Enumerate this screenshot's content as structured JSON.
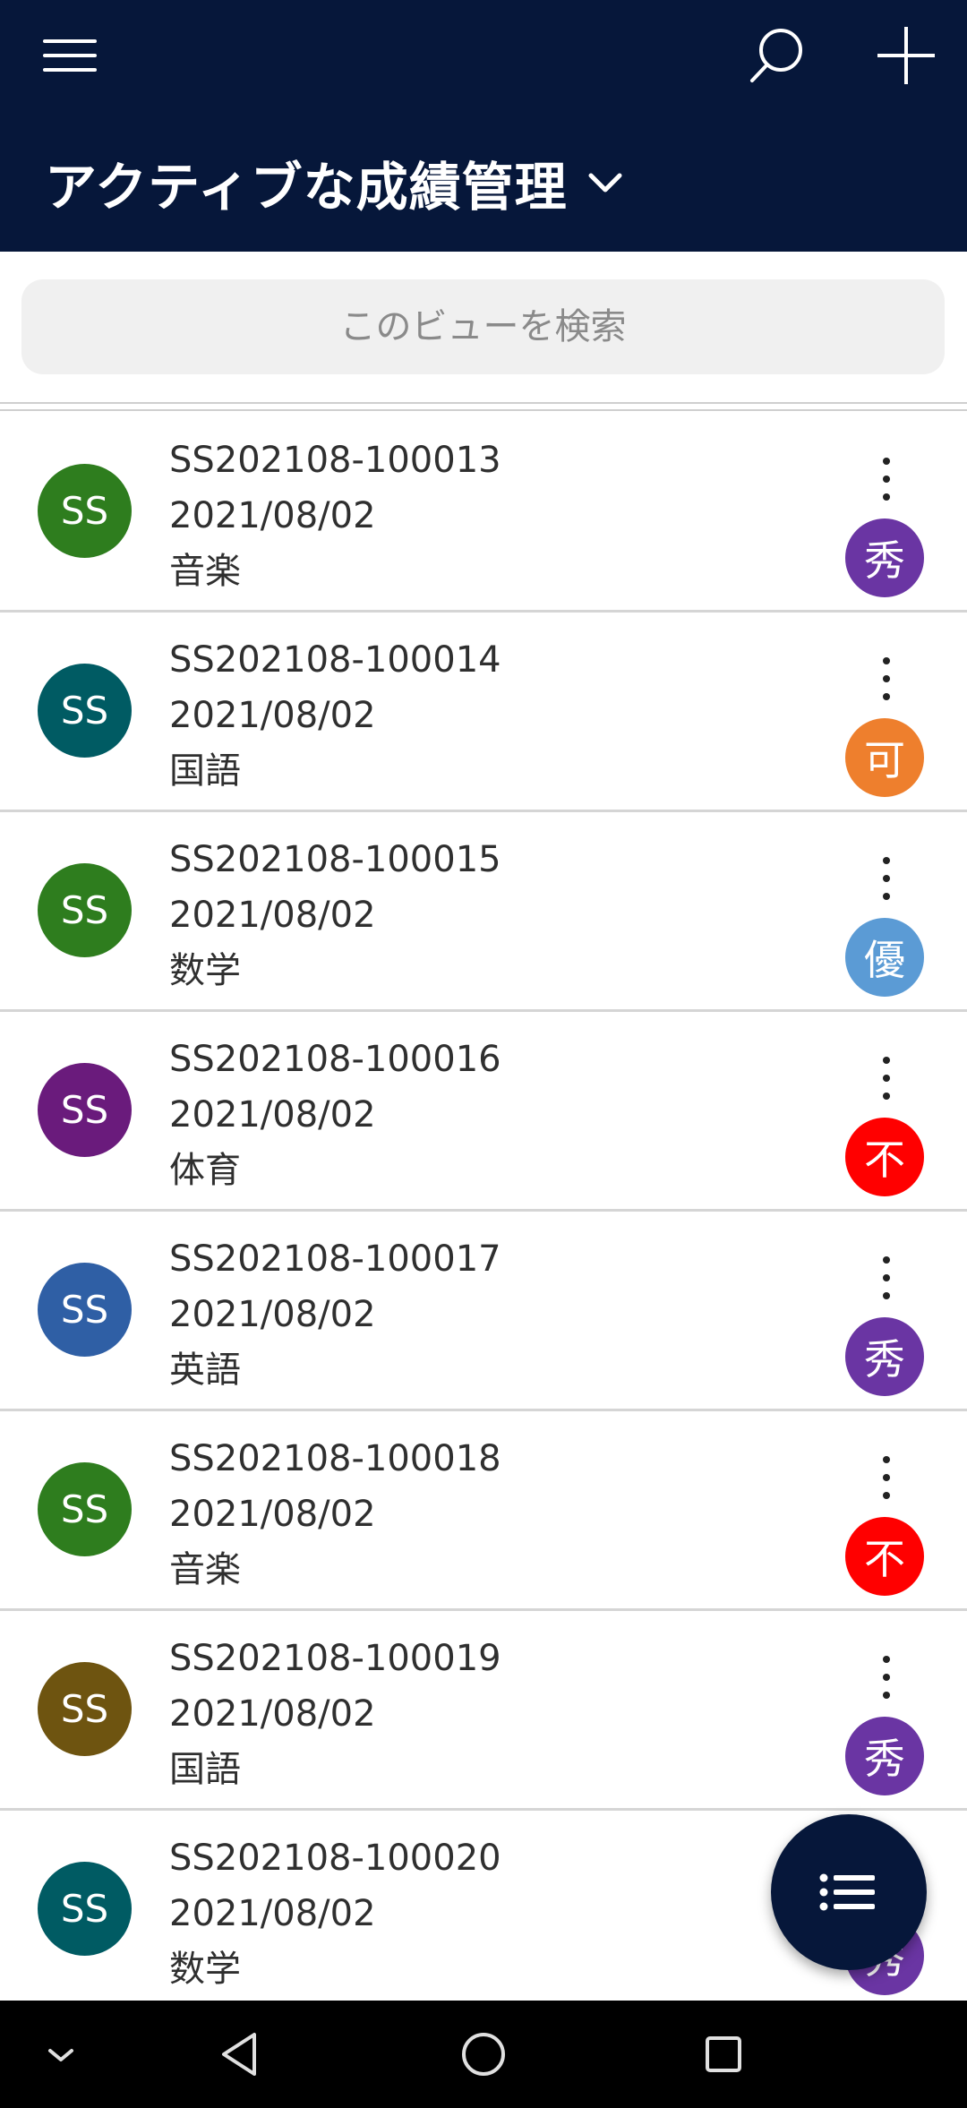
{
  "header": {
    "title": "アクティブな成績管理",
    "menu_icon": "hamburger-menu-icon",
    "search_icon": "search-icon",
    "add_icon": "plus-icon",
    "chevron_icon": "chevron-down-icon",
    "background": "#06173a"
  },
  "search": {
    "placeholder": "このビューを検索"
  },
  "records": [
    {
      "initials": "SS",
      "avatar_color": "#2e7d1e",
      "id": "SS202108-100013",
      "date": "2021/08/02",
      "subject": "音楽",
      "grade": "秀",
      "grade_color": "#6a35a3"
    },
    {
      "initials": "SS",
      "avatar_color": "#005b63",
      "id": "SS202108-100014",
      "date": "2021/08/02",
      "subject": "国語",
      "grade": "可",
      "grade_color": "#ee7f2d"
    },
    {
      "initials": "SS",
      "avatar_color": "#2e7d1e",
      "id": "SS202108-100015",
      "date": "2021/08/02",
      "subject": "数学",
      "grade": "優",
      "grade_color": "#5b9bd5"
    },
    {
      "initials": "SS",
      "avatar_color": "#6a1b7c",
      "id": "SS202108-100016",
      "date": "2021/08/02",
      "subject": "体育",
      "grade": "不",
      "grade_color": "#ff0000"
    },
    {
      "initials": "SS",
      "avatar_color": "#2f5fa5",
      "id": "SS202108-100017",
      "date": "2021/08/02",
      "subject": "英語",
      "grade": "秀",
      "grade_color": "#6a35a3"
    },
    {
      "initials": "SS",
      "avatar_color": "#2e7d1e",
      "id": "SS202108-100018",
      "date": "2021/08/02",
      "subject": "音楽",
      "grade": "不",
      "grade_color": "#ff0000"
    },
    {
      "initials": "SS",
      "avatar_color": "#6e5410",
      "id": "SS202108-100019",
      "date": "2021/08/02",
      "subject": "国語",
      "grade": "秀",
      "grade_color": "#6a35a3"
    },
    {
      "initials": "SS",
      "avatar_color": "#005b63",
      "id": "SS202108-100020",
      "date": "2021/08/02",
      "subject": "数学",
      "grade": "秀",
      "grade_color": "#6a35a3"
    }
  ],
  "fab": {
    "icon": "list-icon",
    "color": "#06173a"
  },
  "system_nav": {
    "icons": [
      "collapse-chevron-icon",
      "back-icon",
      "home-icon",
      "recents-icon"
    ]
  }
}
